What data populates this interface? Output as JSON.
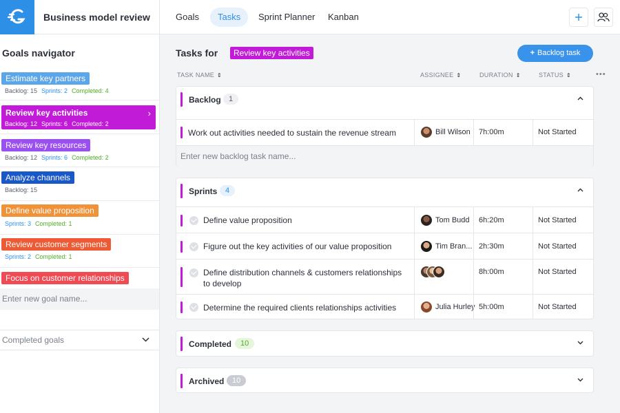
{
  "header": {
    "project_title": "Business model review",
    "tabs": [
      {
        "label": "Goals"
      },
      {
        "label": "Tasks"
      },
      {
        "label": "Sprint Planner"
      },
      {
        "label": "Kanban"
      }
    ],
    "active_tab": "Tasks",
    "add_icon": "plus-icon",
    "users_icon": "users-icon"
  },
  "sidebar": {
    "title": "Goals navigator",
    "goals": [
      {
        "label": "Estimate key partners",
        "color": "#5aa6e8",
        "backlog": "Backlog: 15",
        "sprints": "Sprints: 2",
        "completed": "Completed: 4"
      },
      {
        "label": "Review key activities",
        "color": "#c21bd8",
        "backlog": "Backlog: 12",
        "sprints": "Sprints: 6",
        "completed": "Completed: 2",
        "selected": true
      },
      {
        "label": "Review key resources",
        "color": "#9a4ff0",
        "backlog": "Backlog: 12",
        "sprints": "Sprints: 6",
        "completed": "Completed: 2"
      },
      {
        "label": "Analyze channels",
        "color": "#1a58c8",
        "backlog": "Backlog: 15"
      },
      {
        "label": "Define value proposition",
        "color": "#f0923a",
        "sprints": "Sprints: 3",
        "completed": "Completed: 1"
      },
      {
        "label": "Review customer segments",
        "color": "#ee5a33",
        "sprints": "Sprints: 2",
        "completed": "Completed: 1"
      },
      {
        "label": "Focus on customer relationships",
        "color": "#ee4b55"
      }
    ],
    "new_goal_placeholder": "Enter new goal name...",
    "completed_goals_label": "Completed goals"
  },
  "main": {
    "tasks_for_label": "Tasks for",
    "current_goal": "Review key activities",
    "backlog_button": "Backlog task",
    "columns": {
      "task_name": "TASK NAME",
      "assignee": "ASSIGNEE",
      "duration": "DURATION",
      "status": "STATUS"
    },
    "backlog": {
      "title": "Backlog",
      "count": "1",
      "tasks": [
        {
          "name": "Work out activities needed to sustain the revenue stream",
          "assignee": "Bill Wilson",
          "duration": "7h:00m",
          "status": "Not Started"
        }
      ],
      "new_task_placeholder": "Enter new backlog task name..."
    },
    "sprints": {
      "title": "Sprints",
      "count": "4",
      "tasks": [
        {
          "name": "Define value proposition",
          "assignee": "Tom Budd",
          "duration": "6h:20m",
          "status": "Not Started"
        },
        {
          "name": "Figure out the key activities of our value proposition",
          "assignee": "Tim Bran...",
          "duration": "2h:30m",
          "status": "Not Started"
        },
        {
          "name": "Define distribution channels & customers relationships to develop",
          "assignee": "",
          "duration": "8h:00m",
          "status": "Not Started"
        },
        {
          "name": "Determine the required clients relationships activities",
          "assignee": "Julia Hurley",
          "duration": "5h:00m",
          "status": "Not Started"
        }
      ]
    },
    "completed": {
      "title": "Completed",
      "count": "10"
    },
    "archived": {
      "title": "Archived",
      "count": "10"
    }
  }
}
